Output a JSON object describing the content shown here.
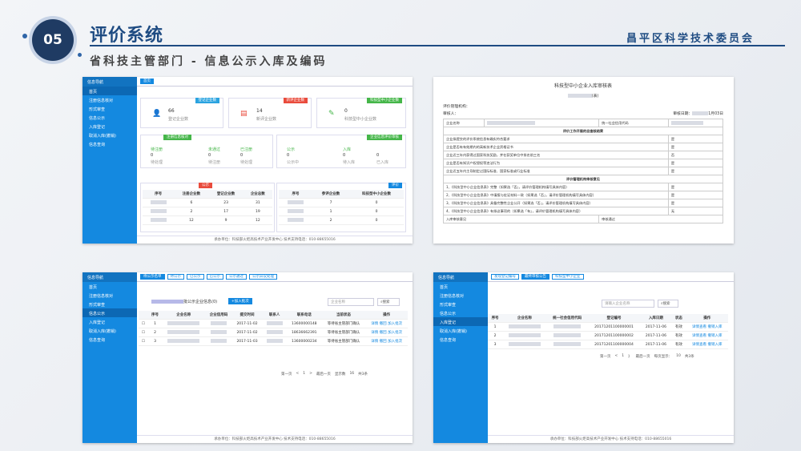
{
  "slide": {
    "num": "05",
    "title": "评价系统",
    "subtitle": "省科技主管部门 - 信息公示入库及编码",
    "org": "昌平区科学技术委员会"
  },
  "sidebar": {
    "header": "信息导航",
    "items": [
      "首页",
      "注册信息核对",
      "形式审查",
      "信息公示",
      "入库登记",
      "取消入库(撤销)",
      "信息查询"
    ]
  },
  "foot": "承办单位：科技部火炬高技术产业开发中心    技术支持电话：010-88655016",
  "s1": {
    "tab": "首页",
    "cards": [
      {
        "tag": "登记企业数",
        "val": "66",
        "lbl": "登记企业数",
        "color": "#2aa3e0"
      },
      {
        "tag": "新评企业数",
        "val": "14",
        "lbl": "新评企业数",
        "color": "#e94b3c"
      },
      {
        "tag": "科技型中小企业数",
        "val": "0",
        "lbl": "科技型中小企业数",
        "color": "#45b649"
      }
    ],
    "reg_tag": "注册信息核对",
    "reg": [
      [
        "待注册",
        "0",
        "待处理"
      ],
      [
        "未通过",
        "0",
        "待注册"
      ],
      [
        "已注册",
        "0",
        "待处理"
      ]
    ],
    "pub_tag": "企业信息评价审核",
    "pub": [
      [
        "公示",
        "0",
        "公示中"
      ],
      [
        "入库",
        "0",
        "待入库"
      ],
      [
        "",
        "0",
        "已入库"
      ]
    ],
    "t1_tag": "公示",
    "t1h": [
      "序号",
      "注册企业数",
      "登记企业数",
      "企业总数"
    ],
    "t1": [
      [
        "",
        "6",
        "23",
        "31"
      ],
      [
        "",
        "2",
        "17",
        "19"
      ],
      [
        "",
        "12",
        "9",
        "12"
      ]
    ],
    "t2_tag": "评价",
    "t2h": [
      "序号",
      "参评企业数",
      "科技型中小企业数"
    ],
    "t2": [
      [
        "",
        "7",
        "0"
      ],
      [
        "",
        "1",
        "0"
      ],
      [
        "",
        "2",
        "0"
      ]
    ]
  },
  "s2": {
    "title": "科技型中小企业入库审核表",
    "sub": "(表)",
    "org_label": "评价管理机构：",
    "reviewer": "审核人：",
    "date": "审核日期：",
    "date_val": "1月03日",
    "company_label": "企业名称",
    "code_label": "统一社会信用代码",
    "sec1": "评价工作开展的自查核结果",
    "rows1": [
      "企业拟提交的评价系统信息有确实符合要求",
      "企业是否有有效期内的高新技术企业资格证书",
      "企业近三年内获得过国家科技奖励，并在获奖单位中排名前三名",
      "企业是否有知识产权侵权等违法行为",
      "企业近五年内主导制定过国际标准、国家标准或行业标准"
    ],
    "vals1": [
      "是",
      "是",
      "否",
      "是",
      "是"
    ],
    "sec2": "评价管理机构审核意见",
    "rows2": [
      "1、《科技型中小企业信息表》完整（如果选「否」，请评价管理机构填写具体内容）",
      "2、《科技型中小企业信息表》中填报与佐证材料一致（如果选「否」，请评价管理机构填写具体内容）",
      "3、《科技型中小企业信息表》具备完整性企业公开（如果选「否」，请评价管理机构填写具体内容）",
      "4、《科技型中小企业信息表》有拟议事项的（如果选「有」，请评价管理机构填写具体内容）"
    ],
    "vals2": [
      "是",
      "是",
      "是",
      "无"
    ],
    "final": "入库审核意见",
    "final_val": "审核通过"
  },
  "s3": {
    "tabs": [
      "待公示名单",
      "待公示",
      "已公示",
      "已公示",
      "公示通过",
      "公示异议处理"
    ],
    "heading": "批公示企业信息(0)",
    "add": "+加入批次",
    "search_ph": "企业名称",
    "search_btn": "搜索",
    "cols": [
      "",
      "序号",
      "企业名称",
      "企业信用码",
      "提交时间",
      "联系人",
      "联系电话",
      "当前状态",
      "操作"
    ],
    "rows": [
      [
        "1",
        "",
        "",
        "2017-11-02",
        "",
        "13600000148",
        "等待省主管部门确认",
        "详情 撤回 加入批次"
      ],
      [
        "2",
        "",
        "",
        "2017-11-02",
        "",
        "18636662391",
        "等待省主管部门确认",
        "详情 撤回 加入批次"
      ],
      [
        "3",
        "",
        "",
        "2017-11-03",
        "",
        "13600000234",
        "等待省主管部门确认",
        "详情 撤回 加入批次"
      ]
    ],
    "pager": [
      "第一页",
      "<",
      "1",
      ">",
      "最后一页",
      "显示数",
      "16"
    ],
    "total": "共3条"
  },
  "s4": {
    "tabs": [
      "发现登记编号",
      "最终审核公告",
      "科技型中小企业"
    ],
    "search_ph": "请输入企业名称",
    "search_btn": "搜索",
    "cols": [
      "序号",
      "企业名称",
      "统一社会信用代码",
      "登记编号",
      "入库日期",
      "状态",
      "操作"
    ],
    "rows": [
      [
        "1",
        "",
        "",
        "20171201100000001",
        "2017-11-06",
        "有效",
        "详情查看 撤销入库"
      ],
      [
        "2",
        "",
        "",
        "20171201100000002",
        "2017-11-06",
        "有效",
        "详情查看 撤销入库"
      ],
      [
        "3",
        "",
        "",
        "20171201100000004",
        "2017-11-06",
        "有效",
        "详情查看 撤销入库"
      ]
    ],
    "pager": [
      "第一页",
      "<",
      "1",
      "》",
      "最后一页",
      "每页显示：",
      "10",
      "共3条"
    ]
  }
}
